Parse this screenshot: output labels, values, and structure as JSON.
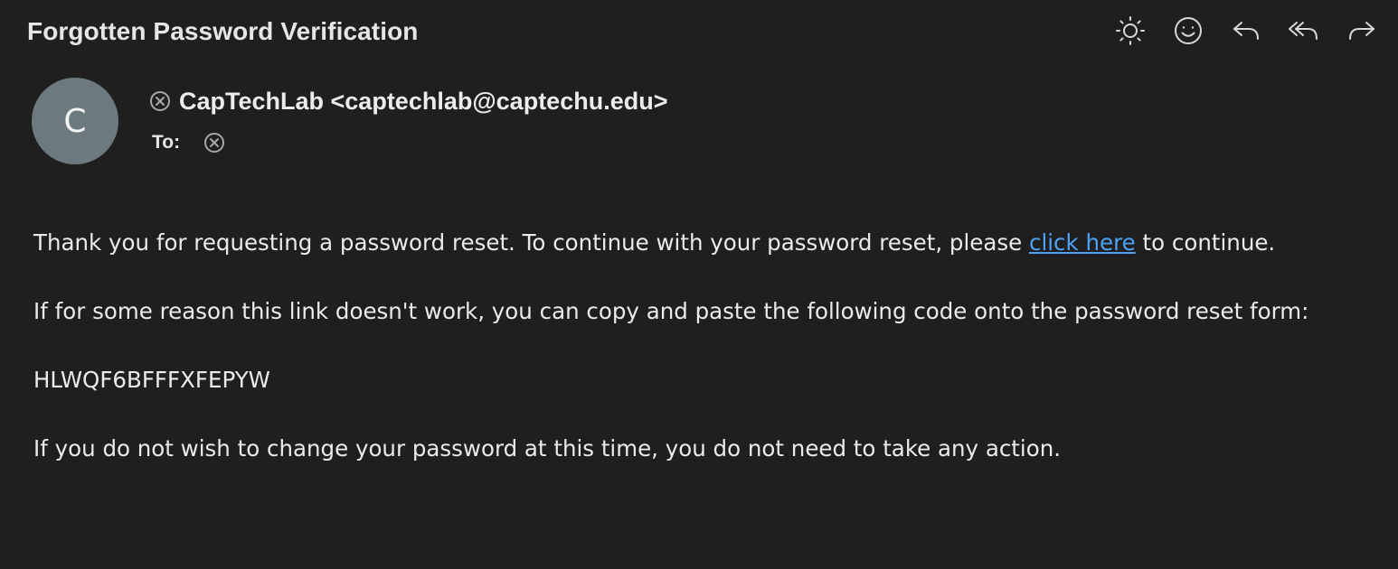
{
  "subject": "Forgotten Password Verification",
  "toolbar": {
    "items": [
      {
        "icon": "sun-icon",
        "action": "theme"
      },
      {
        "icon": "smiley-icon",
        "action": "react"
      },
      {
        "icon": "reply-icon",
        "action": "reply"
      },
      {
        "icon": "reply-all-icon",
        "action": "reply-all"
      },
      {
        "icon": "forward-icon",
        "action": "forward"
      }
    ]
  },
  "sender": {
    "avatar_initial": "C",
    "avatar_color": "#6c7a80",
    "display": "CapTechLab <captechlab@captechu.edu>"
  },
  "recipients": {
    "label": "To:"
  },
  "message": {
    "para1_before": "Thank you for requesting a password reset. To continue with your password reset, please ",
    "para1_link": "click here",
    "para1_after": " to continue.",
    "para2": "If for some reason this link doesn't work, you can copy and paste the following code onto the password reset form:",
    "code": "HLWQF6BFFFXFEPYW",
    "para3": "If you do not wish to change your password at this time, you do not need to take any action."
  },
  "colors": {
    "background": "#1f1f1f",
    "link": "#4ea1f3",
    "text": "#ebebeb"
  }
}
